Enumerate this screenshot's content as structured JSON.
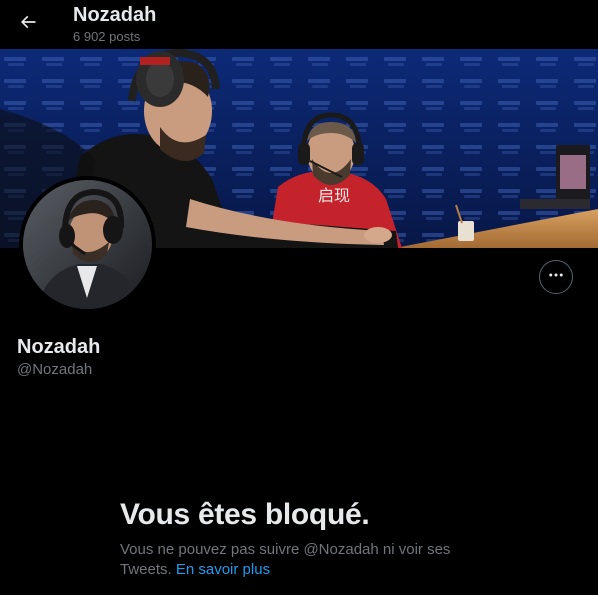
{
  "header": {
    "back_icon": "arrow-left-icon",
    "name": "Nozadah",
    "posts_count": "6 902 posts"
  },
  "banner": {
    "description_icon": "banner-photo",
    "jersey_text": "启现"
  },
  "avatar": {
    "icon": "avatar-photo"
  },
  "actions": {
    "more_icon": "more-horizontal-icon"
  },
  "profile": {
    "name": "Nozadah",
    "handle": "@Nozadah"
  },
  "blocked": {
    "title": "Vous êtes bloqué.",
    "message": "Vous ne pouvez pas suivre @Nozadah ni voir ses Tweets.",
    "link_label": "En savoir plus"
  },
  "colors": {
    "background": "#000000",
    "text_primary": "#e7e9ea",
    "text_secondary": "#71767b",
    "link": "#1d9bf0",
    "border": "#536471"
  }
}
